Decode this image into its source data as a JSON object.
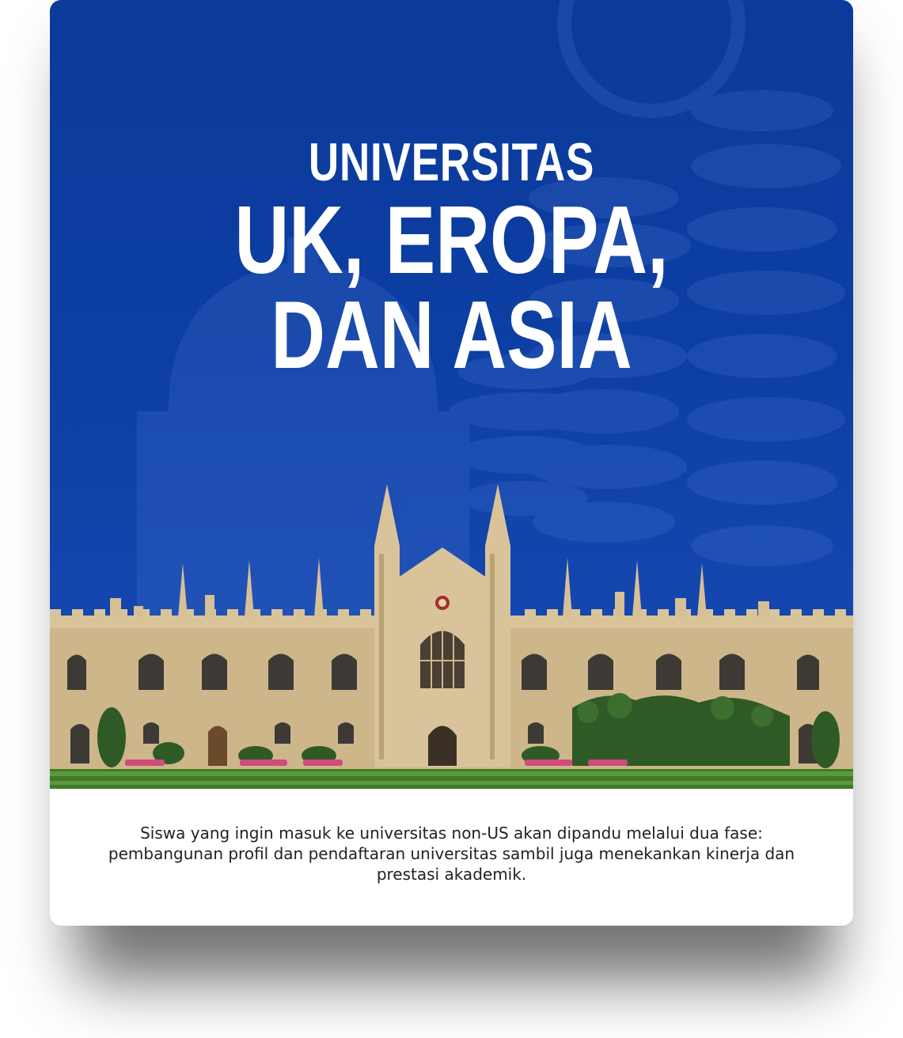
{
  "card": {
    "title_line_1": "UNIVERSITAS",
    "title_line_2": "UK, EROPA,",
    "title_line_3": "DAN ASIA",
    "description": "Siswa yang ingin masuk ke universitas non-US akan dipandu melalui dua fase: pembangunan profil dan pendaftaran universitas sambil juga menekankan kinerja dan prestasi akademik.",
    "accent_color": "#0d3ea3",
    "image_subject": "university-building-photo"
  }
}
